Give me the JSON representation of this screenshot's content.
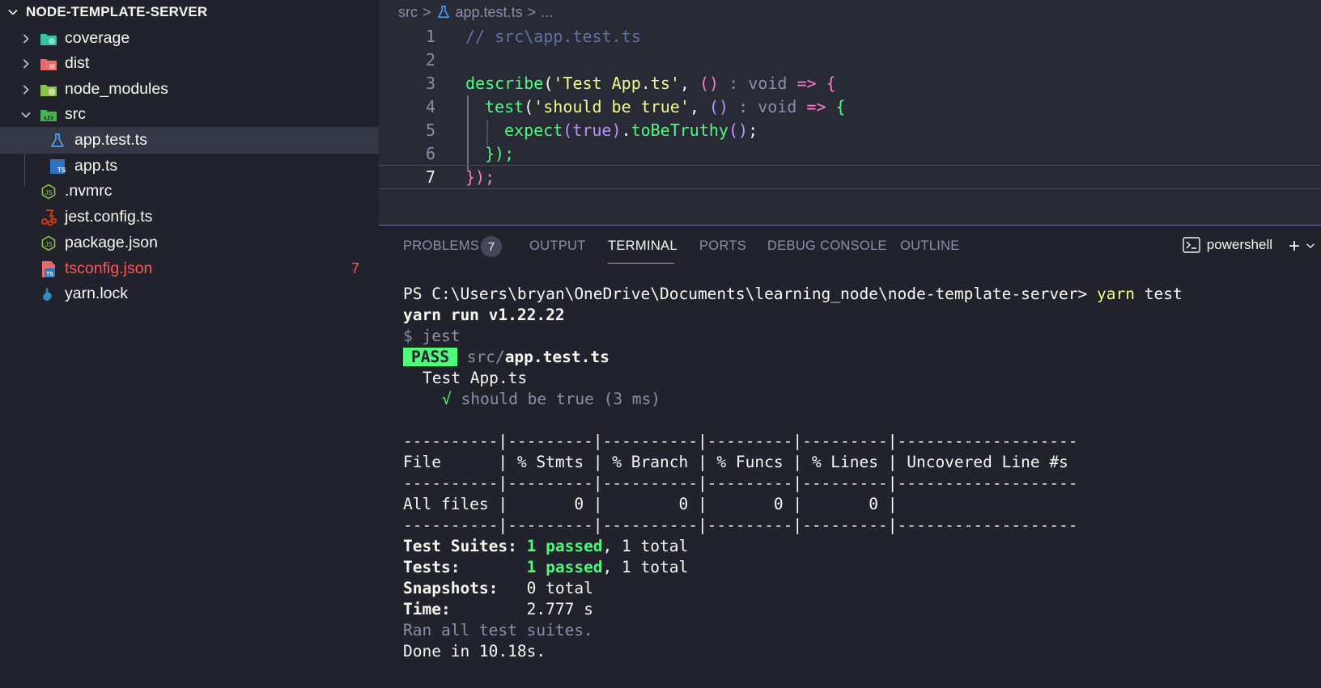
{
  "explorer": {
    "title": "NODE-TEMPLATE-SERVER",
    "items": [
      {
        "label": "coverage",
        "type": "folder",
        "icon": "coverage-folder-icon",
        "color": "#3dbf9e"
      },
      {
        "label": "dist",
        "type": "folder",
        "icon": "dist-folder-icon",
        "color": "#e86b6b"
      },
      {
        "label": "node_modules",
        "type": "folder",
        "icon": "node-modules-folder-icon",
        "color": "#8bc34a"
      },
      {
        "label": "src",
        "type": "folder-open",
        "icon": "src-folder-icon",
        "color": "#4caf50"
      },
      {
        "label": "app.test.ts",
        "type": "file",
        "icon": "test-flask-icon",
        "color": "#4a9ff5"
      },
      {
        "label": "app.ts",
        "type": "file",
        "icon": "typescript-icon",
        "color": "#2f74c0"
      },
      {
        "label": ".nvmrc",
        "type": "file",
        "icon": "nodejs-icon",
        "color": "#8bc34a"
      },
      {
        "label": "jest.config.ts",
        "type": "file",
        "icon": "jest-icon",
        "color": "#c63d14"
      },
      {
        "label": "package.json",
        "type": "file",
        "icon": "nodejs-icon",
        "color": "#8bc34a"
      },
      {
        "label": "tsconfig.json",
        "type": "file",
        "icon": "tsconfig-icon",
        "color": "#2f74c0",
        "error_count": "7"
      },
      {
        "label": "yarn.lock",
        "type": "file",
        "icon": "yarn-icon",
        "color": "#2c8ebb"
      }
    ]
  },
  "editor": {
    "breadcrumb": {
      "root": "src",
      "sep": ">",
      "file": "app.test.ts",
      "more": "..."
    },
    "lines": [
      {
        "num": "1",
        "parts": {
          "comment": "// src\\app.test.ts"
        }
      },
      {
        "num": "2"
      },
      {
        "num": "3",
        "parts": {
          "fn": "describe",
          "open": "(",
          "str": "'Test App.ts'",
          "comma": ", ",
          "parens": "()",
          "colon": " : ",
          "type": "void",
          "arrow": " => ",
          "brace": "{"
        }
      },
      {
        "num": "4",
        "parts": {
          "fn": "test",
          "open": "(",
          "str": "'should be true'",
          "comma": ", ",
          "parens": "()",
          "colon": " : ",
          "type": "void",
          "arrow": " => ",
          "brace": "{"
        }
      },
      {
        "num": "5",
        "parts": {
          "fn": "expect",
          "open": "(",
          "kw": "true",
          "close": ")",
          "dot": ".",
          "fn2": "toBeTruthy",
          "call": "()",
          "semi": ";"
        }
      },
      {
        "num": "6",
        "parts": {
          "brace": "}",
          "close": ");"
        }
      },
      {
        "num": "7",
        "parts": {
          "brace": "}",
          "close": ");"
        }
      }
    ]
  },
  "panel": {
    "tabs": [
      "PROBLEMS",
      "OUTPUT",
      "TERMINAL",
      "PORTS",
      "DEBUG CONSOLE",
      "OUTLINE"
    ],
    "active_tab": "TERMINAL",
    "problems_count": "7",
    "shell": "powershell",
    "terminal": {
      "prompt": "PS C:\\Users\\bryan\\OneDrive\\Documents\\learning_node\\node-template-server> ",
      "cmd1": "yarn",
      "cmd2": " test",
      "yarn_version": "yarn run v1.22.22",
      "jest_cmd": "$ jest",
      "pass": "PASS",
      "src_dir": "src/",
      "test_file": "app.test.ts",
      "suite": "Test App.ts",
      "check": "√",
      "test_result": " should be true (3 ms)",
      "table_sep": "----------|---------|----------|---------|---------|-------------------",
      "table_header": "File      | % Stmts | % Branch | % Funcs | % Lines | Uncovered Line #s",
      "table_row": "All files |       0 |        0 |       0 |       0 |",
      "suites_label": "Test Suites: ",
      "suites_passed": "1 passed",
      "suites_total": ", 1 total",
      "tests_label": "Tests:       ",
      "tests_passed": "1 passed",
      "tests_total": ", 1 total",
      "snap_label": "Snapshots:   ",
      "snap_value": "0 total",
      "time_label": "Time:        ",
      "time_value": "2.777 s",
      "ran": "Ran all test suites.",
      "done": "Done in 10.18s."
    }
  },
  "colors": {
    "background": "#282a36",
    "sidebar": "#21222c",
    "green": "#50fa7b",
    "yellow": "#f1fa8c",
    "pink": "#ff79c6",
    "purple": "#bd93f9",
    "comment": "#6272a4",
    "error": "#ff5555"
  }
}
